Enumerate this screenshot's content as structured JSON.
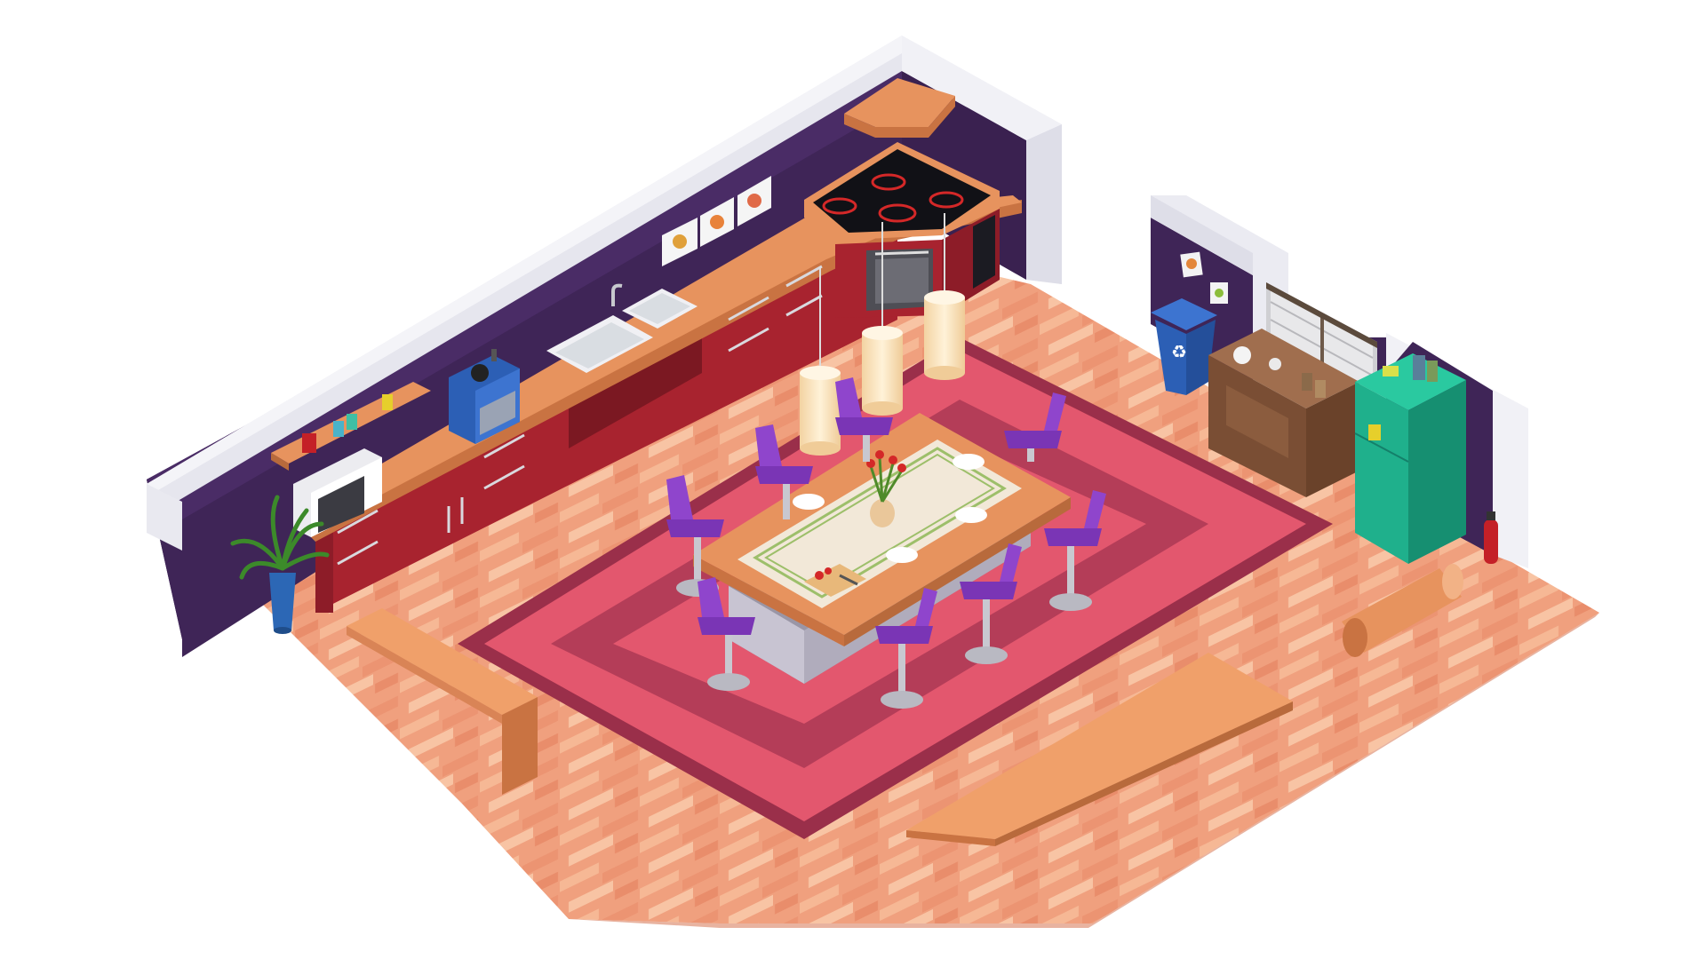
{
  "scene": {
    "description_free": true,
    "colors": {
      "background": "#ffffff",
      "floor": "#f0a07e",
      "floor_light": "#f7bf9e",
      "wall_purple": "#3f2557",
      "wall_cap": "#f4f4f8",
      "rug_outer": "#9a2f4a",
      "rug_mid": "#e3576e",
      "rug_inner": "#b43d58",
      "cabinet_red": "#a8232f",
      "counter_wood": "#e7935e",
      "chair_purple": "#7a35b5",
      "fridge_teal": "#1fb08c",
      "bin_blue": "#2c5fb5",
      "lamp_cream": "#fbe6bf",
      "extinguisher_red": "#c42027"
    },
    "icons": [
      "recycle-icon",
      "potted-plant",
      "microwave",
      "coffee-machine",
      "sink",
      "stove-cooktop",
      "oven",
      "pendant-lamp",
      "dining-table",
      "bar-stool",
      "refrigerator",
      "recycling-bin",
      "sideboard",
      "fire-extinguisher",
      "wall-picture"
    ]
  }
}
